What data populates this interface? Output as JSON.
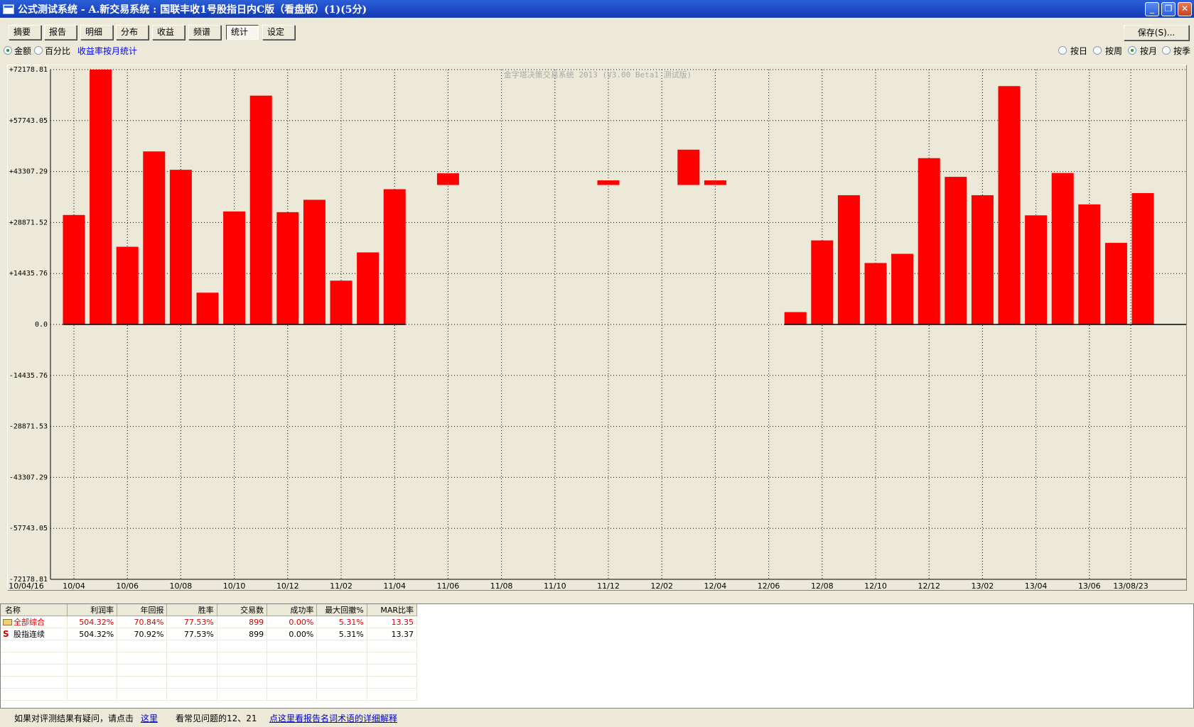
{
  "window": {
    "title": "公式测试系统 - A.新交易系统 : 国联丰收1号股指日内C版（看盘版）(1)(5分)",
    "minimize_label": "_",
    "restore_label": "❐",
    "close_label": "✕"
  },
  "toolbar": {
    "tabs": [
      {
        "label": "摘要"
      },
      {
        "label": "报告"
      },
      {
        "label": "明细"
      },
      {
        "label": "分布"
      },
      {
        "label": "收益"
      },
      {
        "label": "频谱"
      },
      {
        "label": "统计",
        "active": true
      },
      {
        "label": "设定"
      }
    ],
    "save_label": "保存(S)..."
  },
  "options": {
    "amount_label": "金额",
    "percent_label": "百分比",
    "amount_selected": true,
    "monthly_stat_link": "收益率按月统计",
    "period": [
      {
        "label": "按日",
        "selected": false
      },
      {
        "label": "按周",
        "selected": false
      },
      {
        "label": "按月",
        "selected": true
      },
      {
        "label": "按季",
        "selected": false
      }
    ]
  },
  "chart_data": {
    "type": "bar",
    "watermark": "金字塔决策交易系统 2013 (V3.00 Beta1 测试版)",
    "color": "#ff0000",
    "ylim": [
      -72178.81,
      72178.81
    ],
    "yticks": [
      "+72178.81",
      "+57743.05",
      "+43307.29",
      "+28871.52",
      "+14435.76",
      "0.0",
      "-14435.76",
      "-28871.53",
      "-43307.29",
      "-57743.05",
      "-72178.81"
    ],
    "xticks": [
      "10/04/16",
      "10/04",
      "10/06",
      "10/08",
      "10/10",
      "10/12",
      "11/02",
      "11/04",
      "11/06",
      "11/08",
      "11/10",
      "11/12",
      "12/02",
      "12/04",
      "12/06",
      "12/08",
      "12/10",
      "12/12",
      "13/02",
      "13/04",
      "13/06",
      "13/08/23"
    ],
    "bars": [
      {
        "month": "10/04",
        "value": 31000
      },
      {
        "month": "10/05",
        "value": 72178
      },
      {
        "month": "10/06",
        "value": 22000
      },
      {
        "month": "10/07",
        "value": 49000
      },
      {
        "month": "10/08",
        "value": 43800
      },
      {
        "month": "10/09",
        "value": 9000
      },
      {
        "month": "10/10",
        "value": 32000
      },
      {
        "month": "10/11",
        "value": 64800
      },
      {
        "month": "10/12",
        "value": 31800
      },
      {
        "month": "11/01",
        "value": 35300
      },
      {
        "month": "11/02",
        "value": 12400
      },
      {
        "month": "11/03",
        "value": 20400
      },
      {
        "month": "11/04",
        "value": 38300
      },
      {
        "month": "11/06",
        "base": 39500,
        "value": 42800
      },
      {
        "month": "11/12",
        "base": 39500,
        "value": 40800
      },
      {
        "month": "12/03",
        "base": 39500,
        "value": 49500
      },
      {
        "month": "12/04",
        "base": 39500,
        "value": 40800
      },
      {
        "month": "12/07",
        "value": 3500
      },
      {
        "month": "12/08",
        "value": 23800
      },
      {
        "month": "12/09",
        "value": 36600
      },
      {
        "month": "12/10",
        "value": 17400
      },
      {
        "month": "12/11",
        "value": 20000
      },
      {
        "month": "12/12",
        "value": 47100
      },
      {
        "month": "13/01",
        "value": 41800
      },
      {
        "month": "13/02",
        "value": 36600
      },
      {
        "month": "13/03",
        "value": 67500
      },
      {
        "month": "13/04",
        "value": 30900
      },
      {
        "month": "13/05",
        "value": 42900
      },
      {
        "month": "13/06",
        "value": 34000
      },
      {
        "month": "13/07",
        "value": 23100
      },
      {
        "month": "13/08",
        "value": 37200
      }
    ]
  },
  "table": {
    "headers": [
      "名称",
      "利润率",
      "年回报",
      "胜率",
      "交易数",
      "成功率",
      "最大回撤%",
      "MAR比率"
    ],
    "rows": [
      {
        "name": "全部综合",
        "values": [
          "504.32%",
          "70.84%",
          "77.53%",
          "899",
          "0.00%",
          "5.31%",
          "13.35"
        ]
      },
      {
        "name": "股指连续",
        "values": [
          "504.32%",
          "70.92%",
          "77.53%",
          "899",
          "0.00%",
          "5.31%",
          "13.37"
        ]
      }
    ]
  },
  "status": {
    "prompt": "如果对评测结果有疑问，请点击",
    "here_link": "这里",
    "faq": "看常见问题的12、21",
    "glossary_link": "点这里看报告名词术语的详细解释"
  }
}
